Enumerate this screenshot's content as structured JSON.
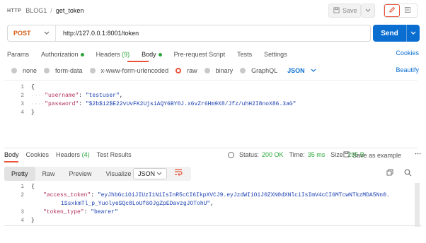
{
  "breadcrumb": {
    "method_badge": "HTTP",
    "collection": "BLOG1",
    "separator": "/",
    "request_name": "get_token"
  },
  "toolbar": {
    "save_label": "Save"
  },
  "request": {
    "method": "POST",
    "url": "http://127.0.0.1:8001/token",
    "send_label": "Send"
  },
  "tabs": {
    "params": "Params",
    "authorization": "Authorization",
    "headers": "Headers",
    "headers_count": "(9)",
    "body": "Body",
    "prerequest": "Pre-request Script",
    "tests": "Tests",
    "settings": "Settings",
    "cookies": "Cookies"
  },
  "body_types": {
    "none": "none",
    "form_data": "form-data",
    "urlencoded": "x-www-form-urlencoded",
    "raw": "raw",
    "binary": "binary",
    "graphql": "GraphQL",
    "format": "JSON",
    "selected": "raw",
    "beautify": "Beautify"
  },
  "request_body": {
    "lines": [
      "1",
      "2",
      "3",
      "4"
    ],
    "open": "{",
    "close": "}",
    "username_key": "\"username\"",
    "username_val": "\"testuser\"",
    "password_key": "\"password\"",
    "password_val": "\"$2b$12$E22vUvFK2UjsiAQY6BY0J.x6vZr6Hm9X8/Jfz/uhH2I8noX86.3aG\""
  },
  "response": {
    "tab_body": "Body",
    "tab_cookies": "Cookies",
    "tab_headers": "Headers",
    "headers_count": "(4)",
    "tab_test_results": "Test Results",
    "status_label": "Status:",
    "status_value": "200 OK",
    "time_label": "Time:",
    "time_value": "35 ms",
    "size_label": "Size:",
    "size_value": "295 B",
    "save_example": "Save as example",
    "views": [
      "Pretty",
      "Raw",
      "Preview",
      "Visualize"
    ],
    "active_view": "Pretty",
    "format": "JSON",
    "lines": [
      "1",
      "2",
      "3",
      "4"
    ],
    "access_token_key": "\"access_token\"",
    "access_token_val_1": "\"eyJhbGciOiJIUzI1NiIsInR5cCI6IkpXVCJ9.eyJzdWIiOiJ0ZXN0dXNlciIsImV4cCI6MTcwNTkzMDA5Nn0.",
    "access_token_val_2": "1SsxkmTl_p_YuolyeSQc8LoUf6OJgZpEDavzgJOTohU\"",
    "token_type_key": "\"token_type\"",
    "token_type_val": "\"bearer\""
  },
  "colors": {
    "accent": "#e8533a",
    "primary": "#0a6ed1",
    "success": "#2ca63c",
    "method_post": "#d4601c"
  }
}
